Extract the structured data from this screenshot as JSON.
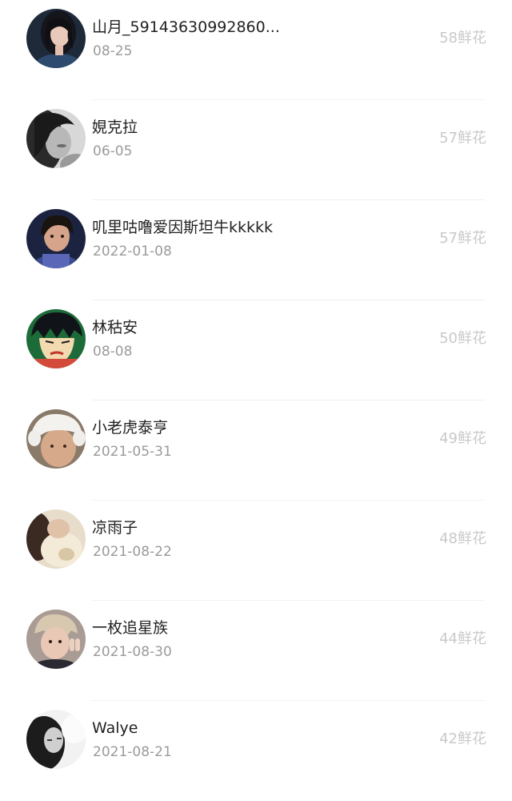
{
  "ranking": {
    "items": [
      {
        "name": "山月_59143630992860...",
        "date": "08-25",
        "flowers": "58鲜花",
        "avatar_icon": "avatar-girl-dark-hair"
      },
      {
        "name": "娊克拉",
        "date": "06-05",
        "flowers": "57鲜花",
        "avatar_icon": "avatar-bw-portrait"
      },
      {
        "name": "叽里咕噜爱因斯坦牛kkkkk",
        "date": "2022-01-08",
        "flowers": "57鲜花",
        "avatar_icon": "avatar-boy-navy"
      },
      {
        "name": "林秙安",
        "date": "08-08",
        "flowers": "50鲜花",
        "avatar_icon": "avatar-anime-boy"
      },
      {
        "name": "小老虎泰亨",
        "date": "2021-05-31",
        "flowers": "49鲜花",
        "avatar_icon": "avatar-hat-white"
      },
      {
        "name": "凉雨子",
        "date": "2021-08-22",
        "flowers": "48鲜花",
        "avatar_icon": "avatar-beige-blur"
      },
      {
        "name": "一枚追星族",
        "date": "2021-08-30",
        "flowers": "44鲜花",
        "avatar_icon": "avatar-peace-sign"
      },
      {
        "name": "Walye",
        "date": "2021-08-21",
        "flowers": "42鲜花",
        "avatar_icon": "avatar-bw-face"
      }
    ]
  }
}
